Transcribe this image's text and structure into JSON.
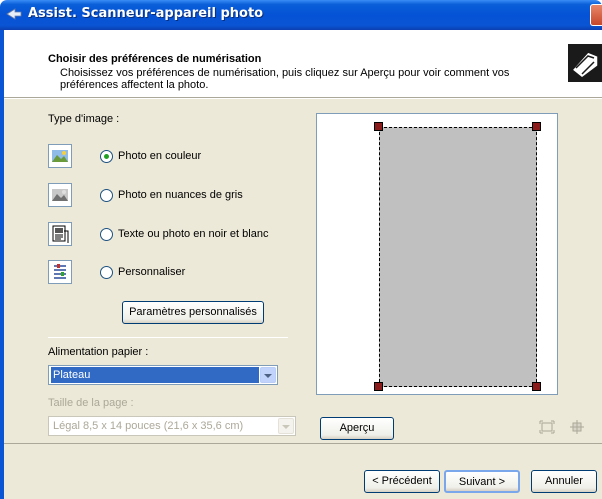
{
  "window": {
    "title": "Assist. Scanneur-appareil photo"
  },
  "header": {
    "title": "Choisir des préférences de numérisation",
    "description": "Choisissez vos préférences de numérisation, puis cliquez sur Aperçu pour voir comment vos préférences affectent la photo."
  },
  "image_type": {
    "label": "Type d'image :",
    "options": [
      {
        "label": "Photo en couleur",
        "selected": true,
        "icon": "color-photo-icon"
      },
      {
        "label": "Photo en nuances de gris",
        "selected": false,
        "icon": "grayscale-photo-icon"
      },
      {
        "label": "Texte ou photo en noir et blanc",
        "selected": false,
        "icon": "bw-text-icon"
      },
      {
        "label": "Personnaliser",
        "selected": false,
        "icon": "custom-settings-icon"
      }
    ],
    "custom_button": "Paramètres personnalisés"
  },
  "paper_source": {
    "label": "Alimentation papier :",
    "value": "Plateau"
  },
  "page_size": {
    "label": "Taille de la page :",
    "value": "Légal 8,5 x 14 pouces (21,6 x 35,6 cm)"
  },
  "preview": {
    "button": "Aperçu"
  },
  "footer": {
    "back": "< Précédent",
    "next": "Suivant >",
    "cancel": "Annuler"
  },
  "colors": {
    "titlebar": "#0552d6",
    "dialog_bg": "#ece9d8",
    "handle": "#8b1a1a",
    "selected_bg": "#316ac5"
  }
}
